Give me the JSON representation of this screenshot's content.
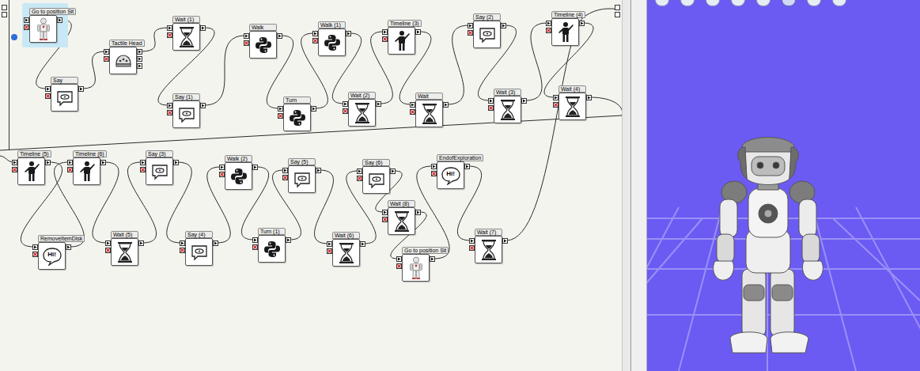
{
  "diagram": {
    "nodes": [
      {
        "label": "Go to position Sit",
        "kind": "posture",
        "selected": true
      },
      {
        "label": "Say",
        "kind": "say",
        "selected": false
      },
      {
        "label": "Tactile Head",
        "kind": "tactile",
        "selected": false
      },
      {
        "label": "Wait (1)",
        "kind": "wait",
        "selected": false
      },
      {
        "label": "Say (1)",
        "kind": "say",
        "selected": false
      },
      {
        "label": "Walk",
        "kind": "python",
        "selected": false
      },
      {
        "label": "Turn",
        "kind": "python",
        "selected": false
      },
      {
        "label": "Walk (1)",
        "kind": "python",
        "selected": false
      },
      {
        "label": "Wait (2)",
        "kind": "wait",
        "selected": false
      },
      {
        "label": "Timeline (3)",
        "kind": "timeline",
        "selected": false
      },
      {
        "label": "Wait",
        "kind": "wait",
        "selected": false
      },
      {
        "label": "Say (2)",
        "kind": "say",
        "selected": false
      },
      {
        "label": "Wait (3)",
        "kind": "wait",
        "selected": false
      },
      {
        "label": "Timeline (4)",
        "kind": "timeline",
        "selected": false
      },
      {
        "label": "Wait (4)",
        "kind": "wait",
        "selected": false
      },
      {
        "label": "Timeline (5)",
        "kind": "timeline",
        "selected": false
      },
      {
        "label": "RemoveItemDisk",
        "kind": "hi",
        "icon_text": "Hi!",
        "selected": false
      },
      {
        "label": "Timeline (6)",
        "kind": "timeline",
        "selected": false
      },
      {
        "label": "Wait (5)",
        "kind": "wait",
        "selected": false
      },
      {
        "label": "Say (3)",
        "kind": "say",
        "selected": false
      },
      {
        "label": "Say (4)",
        "kind": "say",
        "selected": false
      },
      {
        "label": "Walk (2)",
        "kind": "python",
        "selected": false
      },
      {
        "label": "Turn (1)",
        "kind": "python",
        "selected": false
      },
      {
        "label": "Say (5)",
        "kind": "say",
        "selected": false
      },
      {
        "label": "Wait (6)",
        "kind": "wait",
        "selected": false
      },
      {
        "label": "Say (6)",
        "kind": "say",
        "selected": false
      },
      {
        "label": "Wait (8)",
        "kind": "wait",
        "selected": false
      },
      {
        "label": "Go to position Sit",
        "kind": "posture",
        "selected": false
      },
      {
        "label": "EndofExploration",
        "kind": "hi",
        "icon_text": "Hi!",
        "selected": false
      },
      {
        "label": "Wait (7)",
        "kind": "wait",
        "selected": false
      }
    ],
    "edges": [
      [
        0,
        1
      ],
      [
        1,
        2
      ],
      [
        2,
        3
      ],
      [
        3,
        4
      ],
      [
        4,
        5
      ],
      [
        5,
        6
      ],
      [
        6,
        7
      ],
      [
        7,
        8
      ],
      [
        8,
        9
      ],
      [
        9,
        10
      ],
      [
        10,
        11
      ],
      [
        11,
        12
      ],
      [
        12,
        13
      ],
      [
        13,
        14
      ],
      [
        14,
        15
      ],
      [
        15,
        16
      ],
      [
        16,
        17
      ],
      [
        17,
        18
      ],
      [
        18,
        19
      ],
      [
        19,
        20
      ],
      [
        20,
        21
      ],
      [
        21,
        22
      ],
      [
        22,
        23
      ],
      [
        23,
        24
      ],
      [
        24,
        25
      ],
      [
        25,
        26
      ],
      [
        26,
        27
      ],
      [
        27,
        28
      ],
      [
        28,
        29
      ]
    ]
  },
  "robot_view": {
    "toolbar_buttons": [
      {
        "selected": false
      },
      {
        "selected": false
      },
      {
        "selected": false
      },
      {
        "selected": false
      },
      {
        "selected": false
      },
      {
        "selected": true
      },
      {
        "selected": false
      },
      {
        "selected": false
      }
    ]
  }
}
